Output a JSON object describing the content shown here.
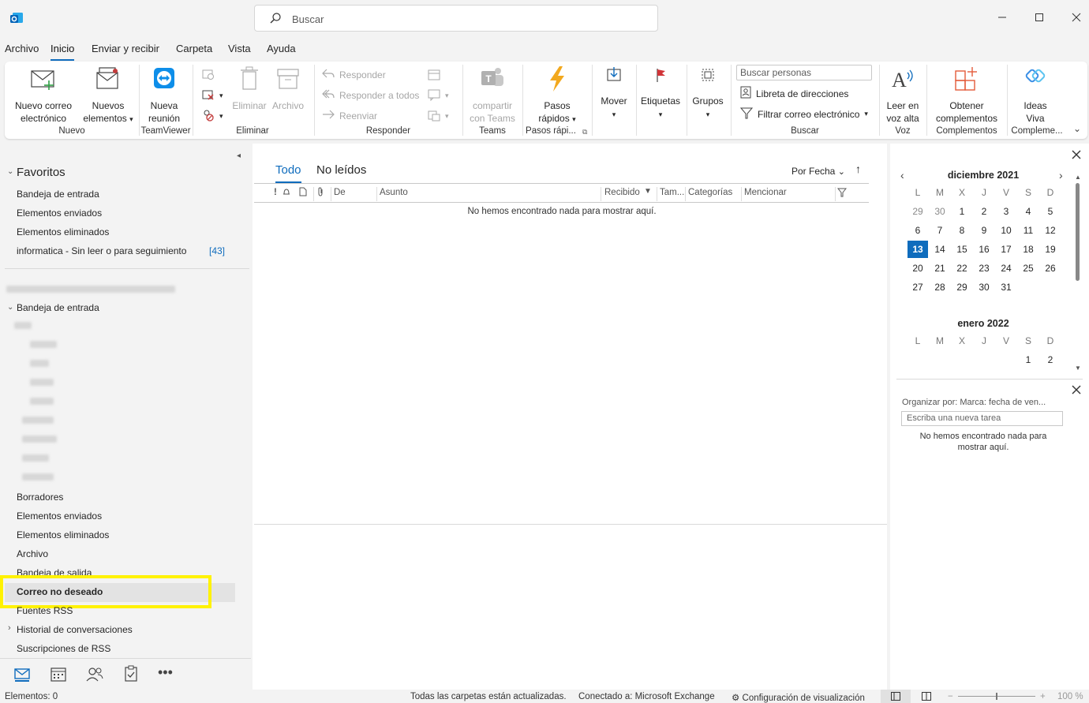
{
  "app": {
    "icon": "outlook-icon"
  },
  "search": {
    "placeholder": "Buscar"
  },
  "window_controls": {
    "minimize": "minimize-icon",
    "maximize": "maximize-icon",
    "close": "close-icon"
  },
  "menu": {
    "tabs": [
      "Archivo",
      "Inicio",
      "Enviar y recibir",
      "Carpeta",
      "Vista",
      "Ayuda"
    ],
    "active": "Inicio"
  },
  "ribbon": {
    "nuevo": {
      "label": "Nuevo",
      "new_mail": [
        "Nuevo correo",
        "electrónico"
      ],
      "new_items": [
        "Nuevos",
        "elementos"
      ]
    },
    "teamviewer": {
      "label": "TeamViewer",
      "meeting": [
        "Nueva",
        "reunión"
      ]
    },
    "eliminar": {
      "label": "Eliminar",
      "delete": "Eliminar",
      "archive": "Archivo"
    },
    "responder": {
      "label": "Responder",
      "reply": "Responder",
      "reply_all": "Responder a todos",
      "forward": "Reenviar"
    },
    "teams": {
      "label": "Teams",
      "share": [
        "compartir",
        "con Teams"
      ]
    },
    "quicksteps": {
      "label": "Pasos rápi...",
      "button": [
        "Pasos",
        "rápidos"
      ]
    },
    "move": {
      "label": "Mover"
    },
    "tags": {
      "label": "Etiquetas"
    },
    "groups": {
      "label": "Grupos"
    },
    "buscar": {
      "label": "Buscar",
      "people_placeholder": "Buscar personas",
      "address_book": "Libreta de direcciones",
      "filter": "Filtrar correo electrónico"
    },
    "voz": {
      "label": "Voz",
      "read_aloud": [
        "Leer en",
        "voz alta"
      ]
    },
    "complementos": {
      "label": "Complementos",
      "get": [
        "Obtener",
        "complementos"
      ]
    },
    "viva": {
      "label": "Compleme...",
      "ideas": [
        "Ideas",
        "Viva"
      ]
    }
  },
  "folders": {
    "favorites_title": "Favoritos",
    "favorites": [
      "Bandeja de entrada",
      "Elementos enviados",
      "Elementos eliminados",
      "informatica - Sin leer o para seguimiento"
    ],
    "favorites_count": "[43]",
    "inbox": "Bandeja de entrada",
    "others": [
      "Borradores",
      "Elementos enviados",
      "Elementos eliminados",
      "Archivo",
      "Bandeja de salida",
      "Correo no deseado",
      "Fuentes RSS",
      "Historial de conversaciones",
      "Suscripciones de RSS"
    ]
  },
  "messages": {
    "tab_all": "Todo",
    "tab_unread": "No leídos",
    "sort": "Por Fecha",
    "columns": {
      "importance": "!",
      "from": "De",
      "subject": "Asunto",
      "received": "Recibido",
      "size": "Tam...",
      "categories": "Categorías",
      "mention": "Mencionar"
    },
    "empty": "No hemos encontrado nada para mostrar aquí."
  },
  "calendar": {
    "month1": "diciembre 2021",
    "month2": "enero 2022",
    "weekdays": [
      "L",
      "M",
      "X",
      "J",
      "V",
      "S",
      "D"
    ],
    "dec_weeks": [
      [
        "29",
        "30",
        "1",
        "2",
        "3",
        "4",
        "5"
      ],
      [
        "6",
        "7",
        "8",
        "9",
        "10",
        "11",
        "12"
      ],
      [
        "13",
        "14",
        "15",
        "16",
        "17",
        "18",
        "19"
      ],
      [
        "20",
        "21",
        "22",
        "23",
        "24",
        "25",
        "26"
      ],
      [
        "27",
        "28",
        "29",
        "30",
        "31",
        "",
        ""
      ]
    ],
    "jan_first": [
      "",
      "",
      "",
      "",
      "",
      "1",
      "2"
    ],
    "today": "13"
  },
  "tasks": {
    "arrange": "Organizar por: Marca: fecha de ven...",
    "new_task_placeholder": "Escriba una nueva tarea",
    "empty": "No hemos encontrado nada para mostrar aquí."
  },
  "status": {
    "items": "Elementos: 0",
    "updated": "Todas las carpetas están actualizadas.",
    "connected": "Conectado a: Microsoft Exchange",
    "display_settings": "Configuración de visualización",
    "zoom": "100 %"
  }
}
